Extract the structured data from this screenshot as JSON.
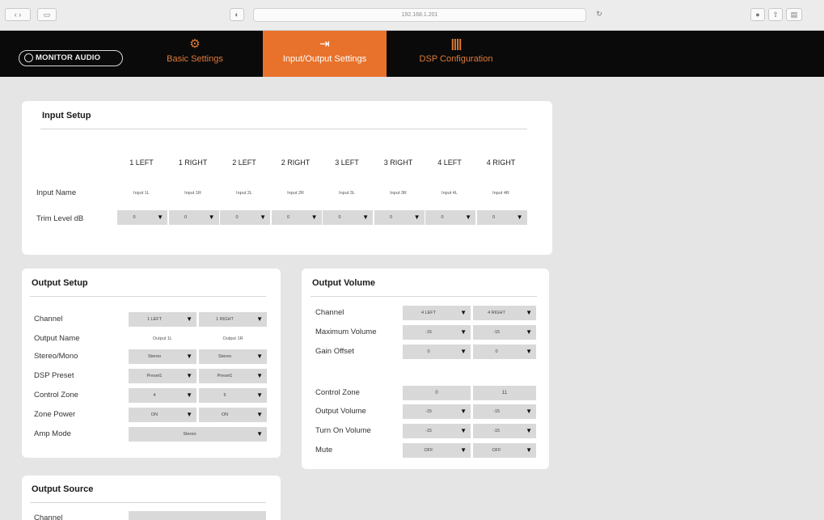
{
  "browser": {
    "url": "192.168.1.201"
  },
  "header": {
    "logo": "MONITOR AUDIO",
    "tabs": [
      {
        "label": "Basic Settings",
        "icon": "gears-icon",
        "glyph": "⚙"
      },
      {
        "label": "Input/Output Settings",
        "icon": "input-output-icon",
        "glyph": "⇥"
      },
      {
        "label": "DSP Configuration",
        "icon": "dsp-bars-icon",
        "glyph": "||||"
      }
    ],
    "active_tab": 1
  },
  "input_setup": {
    "title": "Input Setup",
    "columns": [
      "1 LEFT",
      "1 RIGHT",
      "2 LEFT",
      "2 RIGHT",
      "3 LEFT",
      "3 RIGHT",
      "4 LEFT",
      "4 RIGHT"
    ],
    "name_label": "Input Name",
    "names": [
      "Input 1L",
      "Input 1R",
      "Input 2L",
      "Input 2R",
      "Input 3L",
      "Input 3R",
      "Input 4L",
      "Input 4R"
    ],
    "trim_label": "Trim Level dB",
    "trims": [
      "0",
      "0",
      "0",
      "0",
      "0",
      "0",
      "0",
      "0"
    ]
  },
  "output_setup": {
    "title": "Output Setup",
    "rows": [
      {
        "label": "Channel",
        "type": "select",
        "values": [
          "1 LEFT",
          "1 RIGHT"
        ]
      },
      {
        "label": "Output Name",
        "type": "text",
        "values": [
          "Output 1L",
          "Output 1R"
        ]
      },
      {
        "label": "Stereo/Mono",
        "type": "select",
        "values": [
          "Stereo",
          "Stereo"
        ]
      },
      {
        "label": "DSP Preset",
        "type": "select",
        "values": [
          "Preset1",
          "Preset1"
        ]
      },
      {
        "label": "Control Zone",
        "type": "select",
        "values": [
          "4",
          "5"
        ]
      },
      {
        "label": "Zone Power",
        "type": "select",
        "values": [
          "ON",
          "ON"
        ]
      },
      {
        "label": "Amp Mode",
        "type": "wide",
        "values": [
          "Stereo"
        ]
      }
    ]
  },
  "output_volume": {
    "title": "Output Volume",
    "rows": [
      {
        "label": "Channel",
        "type": "select",
        "values": [
          "4 LEFT",
          "4 RIGHT"
        ]
      },
      {
        "label": "Maximum Volume",
        "type": "select",
        "values": [
          "-15",
          "-15"
        ]
      },
      {
        "label": "Gain Offset",
        "type": "select",
        "values": [
          "0",
          "0"
        ]
      },
      {
        "label": "Control Zone",
        "type": "readonly",
        "values": [
          "0",
          "11"
        ]
      },
      {
        "label": "Output Volume",
        "type": "select",
        "values": [
          "-15",
          "-15"
        ]
      },
      {
        "label": "Turn On Volume",
        "type": "select",
        "values": [
          "-15",
          "-15"
        ]
      },
      {
        "label": "Mute",
        "type": "select",
        "values": [
          "OFF",
          "OFF"
        ]
      }
    ]
  },
  "output_source": {
    "title": "Output Source",
    "rows": [
      {
        "label": "Channel"
      }
    ]
  },
  "colors": {
    "accent": "#e8722c",
    "header_bg": "#0a0a0a",
    "page_bg": "#e5e5e5",
    "field_bg": "#d9d9d9"
  }
}
